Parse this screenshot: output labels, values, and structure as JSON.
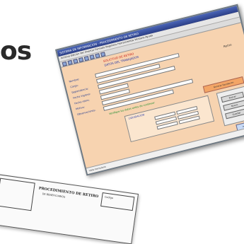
{
  "background_text": "os",
  "screen": {
    "title": "SISTEMA DE INFORMACION - PROCEDIMIENTO DE RETIRO",
    "menu": "Archivo  Edicion  Ver  Insertar  Formato  Registros  Herramientas  Ventana  Ayuda",
    "header_red": "SOLICITUD DE RETIRO",
    "header_blue": "DATOS DEL TRABAJADOR",
    "rows": [
      {
        "label": "Nombre:"
      },
      {
        "label": "Cargo:"
      },
      {
        "label": "Dependencia:"
      },
      {
        "label": "Fecha ingreso:"
      },
      {
        "label": "Fecha retiro:"
      },
      {
        "label": "Motivo:"
      },
      {
        "label": "Observaciones:"
      }
    ],
    "green_note": "Verifique los datos antes de continuar",
    "panel_title": "LIQUIDACION",
    "orange_button": "Generar liquidacion",
    "side_buttons": [
      "Buscar",
      "Nuevo",
      "Guardar"
    ],
    "blue_button": "Imprimir",
    "status": "Vista Formulario",
    "right_value": "Retiro"
  },
  "paper": {
    "title": "PROCEDIMIENTO DE RETIRO",
    "subtitle": "DE BENEFICIARIOS",
    "code": "Codigo"
  }
}
